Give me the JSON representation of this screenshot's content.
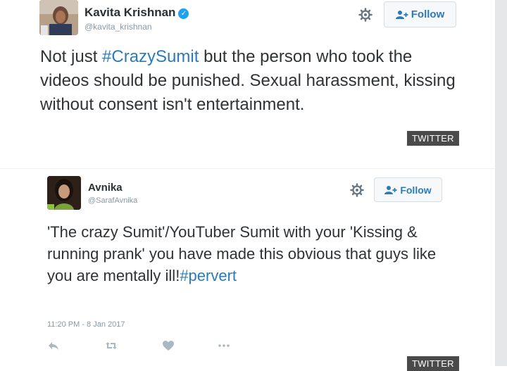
{
  "tweets": [
    {
      "name": "Kavita Krishnan",
      "handle": "@kavita_krishnan",
      "follow_label": "Follow",
      "text_before": "Not just ",
      "hashtag": "#CrazySumit",
      "text_after": " but the person who took the videos should be punished. Sexual harassment, kissing without consent isn't entertainment.",
      "source": "TWITTER",
      "verified_mark": "✓"
    },
    {
      "name": "Avnika",
      "handle": "@SarafAvnika",
      "follow_label": "Follow",
      "text_before": "'The crazy Sumit'/YouTuber Sumit with your 'Kissing & running prank' you have made this obvious that guys like you are mentally ill!",
      "hashtag": "#pervert",
      "timestamp": "11:20 PM - 8 Jan 2017",
      "source": "TWITTER"
    }
  ],
  "colors": {
    "link": "#2b7bb9",
    "verified": "#1da1f2",
    "muted": "#8899a6",
    "badge_bg": "#4a4a4a"
  },
  "icons": [
    "verified-icon",
    "gear-icon",
    "follow-person-icon",
    "reply-icon",
    "retweet-icon",
    "like-icon",
    "more-icon"
  ]
}
